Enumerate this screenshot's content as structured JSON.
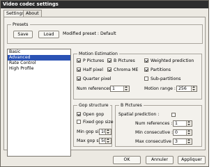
{
  "window": {
    "title": "Video codec settings"
  },
  "tabs": [
    {
      "label": "Settings"
    },
    {
      "label": "About"
    }
  ],
  "presets": {
    "title": "Presets",
    "save_label": "Save",
    "load_label": "Load",
    "status": "Modified preset : Default"
  },
  "categories": [
    "Basic",
    "Advanced",
    "Rate Control",
    "High Profile"
  ],
  "selected_category": "Advanced",
  "motion": {
    "title": "Motion Estimation",
    "p_pictures": {
      "label": "P Pictures",
      "checked": true
    },
    "b_pictures": {
      "label": "B Pictures",
      "checked": true
    },
    "weighted_prediction": {
      "label": "Weighted prediction",
      "checked": true
    },
    "half_pixel": {
      "label": "Half pixel",
      "checked": true
    },
    "chroma_me": {
      "label": "Chroma ME",
      "checked": true
    },
    "partitions": {
      "label": "Partitions",
      "checked": true
    },
    "quarter_pixel": {
      "label": "Quarter pixel",
      "checked": true
    },
    "sub_partitions": {
      "label": "Sub-partitions",
      "checked": false
    },
    "num_references": {
      "label": "Num references :",
      "value": "1"
    },
    "motion_range": {
      "label": "Motion range :",
      "value": "256"
    }
  },
  "gop": {
    "title": "Gop structure",
    "open_gop": {
      "label": "Open gop",
      "checked": true
    },
    "fixed_gop_size": {
      "label": "Fixed gop size",
      "checked": false
    },
    "min_gop_size": {
      "label": "Min gop size :",
      "value": "10"
    },
    "max_gop_size": {
      "label": "Max gop size :",
      "value": "50"
    }
  },
  "bpictures": {
    "title": "B Pictures",
    "spatial_prediction": {
      "label": "Spatial prediction :",
      "checked": false
    },
    "num_references": {
      "label": "Num references :",
      "value": "1"
    },
    "min_consecutive": {
      "label": "Min consecutive :",
      "value": "0"
    },
    "max_consecutive": {
      "label": "Max consecutive :",
      "value": "3"
    }
  },
  "footer": {
    "ok_label": "OK",
    "cancel_label": "Annuler",
    "apply_label": "Appliquer"
  }
}
